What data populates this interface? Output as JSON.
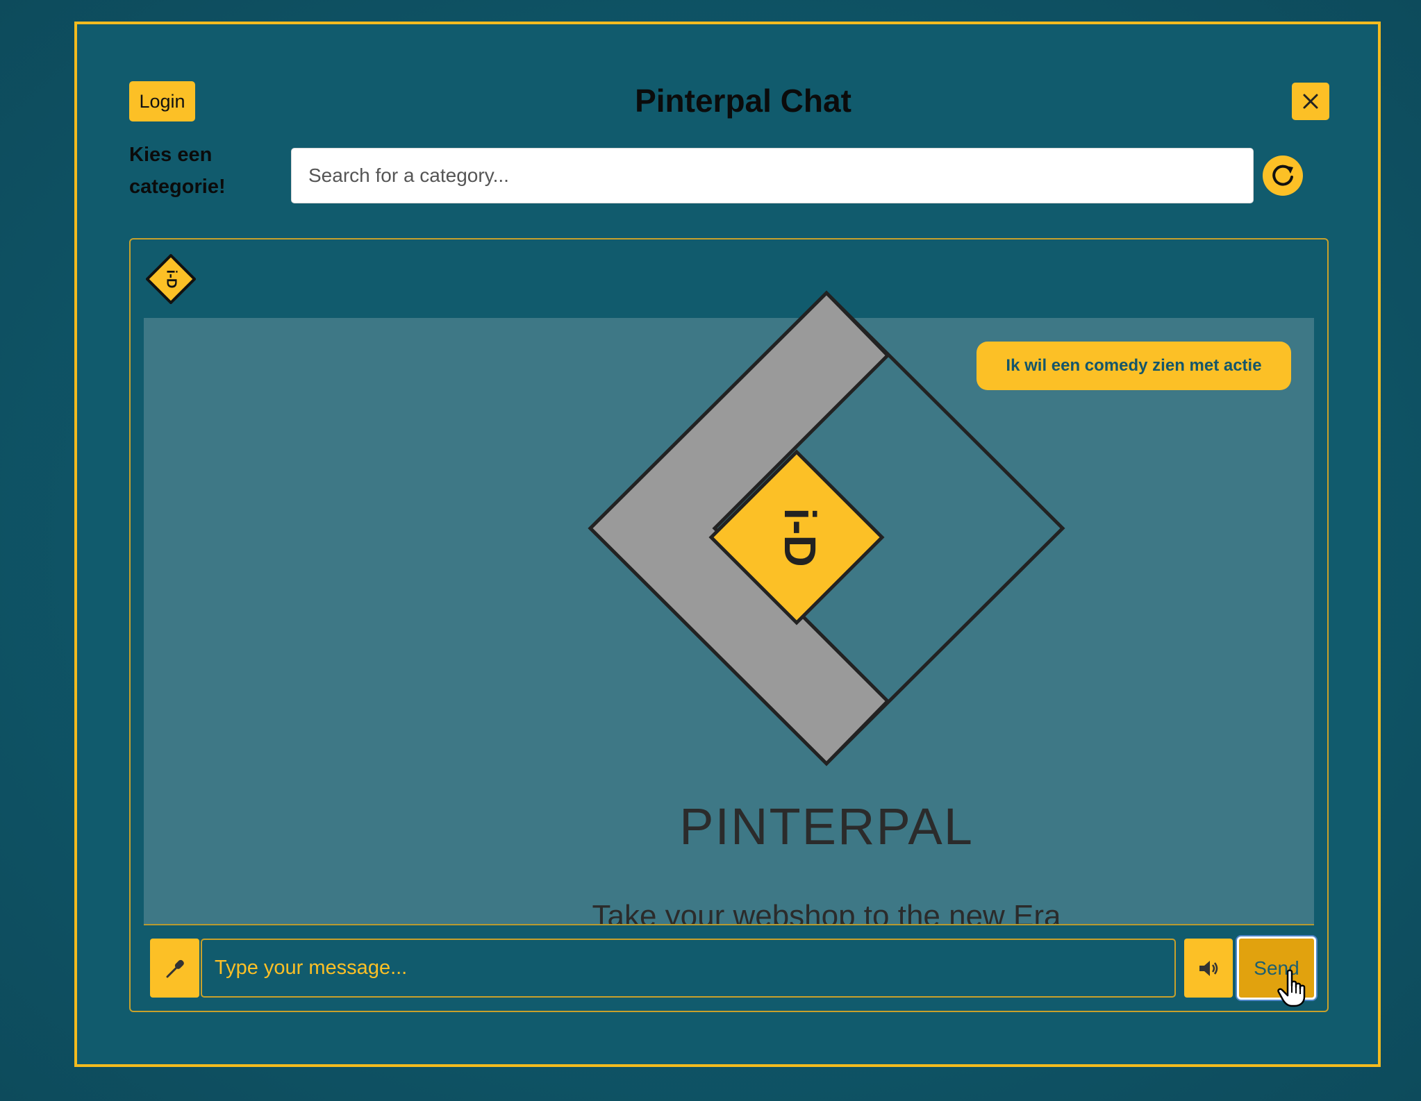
{
  "header": {
    "login_label": "Login",
    "title": "Pinterpal Chat",
    "close_icon": "close-icon"
  },
  "category": {
    "label": "Kies een categorie!",
    "search_placeholder": "Search for a category...",
    "search_value": "",
    "refresh_icon": "refresh-icon"
  },
  "chat": {
    "logo_icon": "pinterpal-logo-icon",
    "logo_glyph": "i-D",
    "brand_name": "PINTERPAL",
    "tagline": "Take your webshop to the new Era",
    "messages": [
      {
        "sender": "user",
        "text": "Ik wil een comedy zien met actie"
      }
    ]
  },
  "composer": {
    "mic_icon": "microphone-icon",
    "message_placeholder": "Type your message...",
    "message_value": "",
    "speaker_icon": "speaker-icon",
    "send_label": "Send"
  },
  "colors": {
    "background": "#115b6d",
    "accent": "#fcc026",
    "chat_area": "#3e7886",
    "text_dark": "#0b0b0b"
  }
}
